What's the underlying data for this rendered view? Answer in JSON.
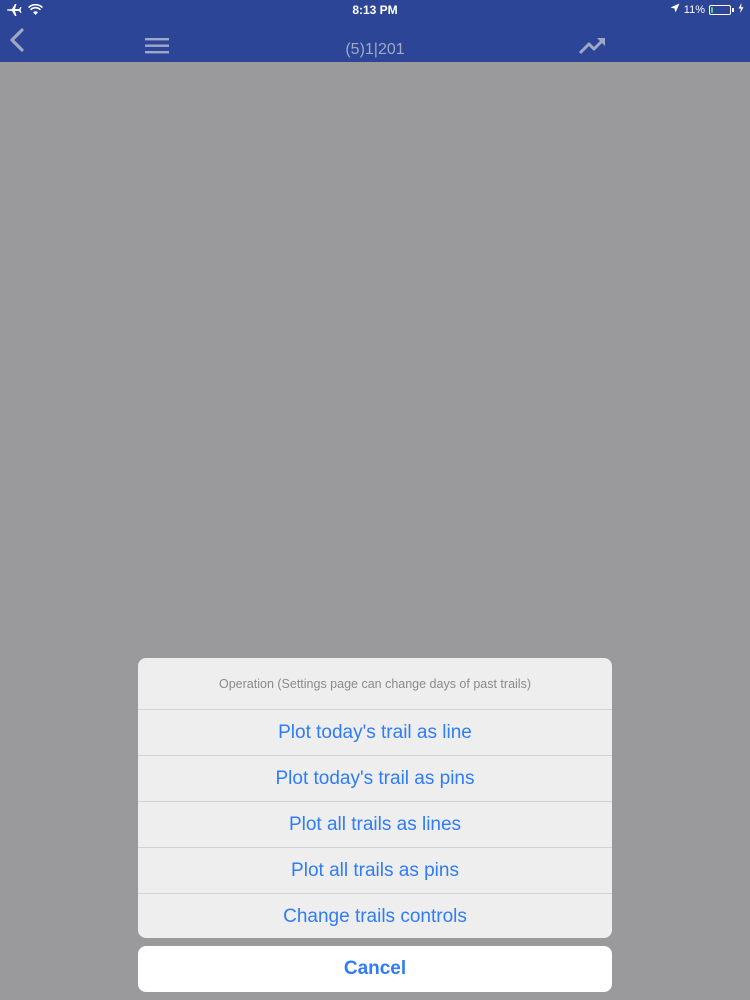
{
  "status_bar": {
    "time": "8:13 PM",
    "battery_text": "11%",
    "battery_level": 0.11,
    "icons": [
      "airplane-icon",
      "wifi-icon",
      "location-arrow-icon",
      "battery-icon",
      "charging-bolt-icon"
    ]
  },
  "nav": {
    "title": "(5)1|201",
    "icons": [
      "back-chevron-icon",
      "hamburger-menu-icon",
      "trending-up-icon"
    ]
  },
  "action_sheet": {
    "header": "Operation (Settings page can change days of past trails)",
    "items": [
      {
        "label": "Plot today's trail as line"
      },
      {
        "label": "Plot today's trail as pins"
      },
      {
        "label": "Plot all trails as lines"
      },
      {
        "label": "Plot all trails as pins"
      },
      {
        "label": "Change trails controls"
      }
    ],
    "cancel_label": "Cancel"
  },
  "colors": {
    "nav_background": "#2c4596",
    "dimmed_background": "#9a999b",
    "action_text": "#2f7cf6",
    "battery_fill": "#4cd964"
  }
}
